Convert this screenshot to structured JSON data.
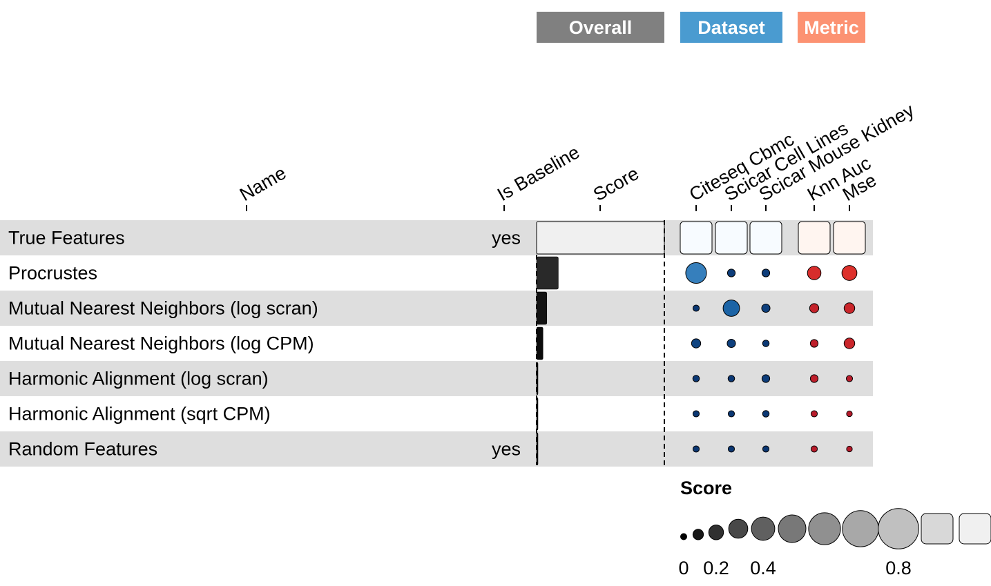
{
  "chart_data": {
    "type": "table",
    "groups": [
      {
        "label": "Overall",
        "color": "#808080"
      },
      {
        "label": "Dataset",
        "color": "#4A9BD0"
      },
      {
        "label": "Metric",
        "color": "#FC9272"
      }
    ],
    "columns": {
      "name": "Name",
      "is_baseline": "Is Baseline",
      "score": "Score",
      "datasets": [
        "Citeseq Cbmc",
        "Scicar Cell Lines",
        "Scicar Mouse Kidney"
      ],
      "metrics": [
        "Knn Auc",
        "Mse"
      ]
    },
    "rows": [
      {
        "name": "True Features",
        "is_baseline": "yes",
        "score": 1.0,
        "datasets": [
          1.0,
          1.0,
          1.0
        ],
        "metrics": [
          1.0,
          1.0
        ]
      },
      {
        "name": "Procrustes",
        "is_baseline": "",
        "score": 0.17,
        "datasets": [
          0.55,
          0.1,
          0.1
        ],
        "metrics": [
          0.3,
          0.35
        ]
      },
      {
        "name": "Mutual Nearest Neighbors (log scran)",
        "is_baseline": "",
        "score": 0.08,
        "datasets": [
          0.05,
          0.4,
          0.12
        ],
        "metrics": [
          0.15,
          0.2
        ]
      },
      {
        "name": "Mutual Nearest Neighbors (log CPM)",
        "is_baseline": "",
        "score": 0.05,
        "datasets": [
          0.15,
          0.12,
          0.06
        ],
        "metrics": [
          0.1,
          0.2
        ]
      },
      {
        "name": "Harmonic Alignment (log scran)",
        "is_baseline": "",
        "score": 0.01,
        "datasets": [
          0.06,
          0.06,
          0.1
        ],
        "metrics": [
          0.1,
          0.05
        ]
      },
      {
        "name": "Harmonic Alignment (sqrt CPM)",
        "is_baseline": "",
        "score": 0.0,
        "datasets": [
          0.05,
          0.05,
          0.06
        ],
        "metrics": [
          0.05,
          0.03
        ]
      },
      {
        "name": "Random Features",
        "is_baseline": "yes",
        "score": 0.0,
        "datasets": [
          0.05,
          0.05,
          0.05
        ],
        "metrics": [
          0.05,
          0.03
        ]
      }
    ],
    "legend": {
      "title": "Score",
      "steps": [
        0,
        0.1,
        0.2,
        0.3,
        0.4,
        0.5,
        0.6,
        0.7,
        0.8,
        0.9,
        1.0
      ],
      "tick_labels": [
        {
          "label": "0",
          "value": 0
        },
        {
          "label": "0.2",
          "value": 0.2
        },
        {
          "label": "0.4",
          "value": 0.4
        },
        {
          "label": "0.8",
          "value": 0.8
        }
      ]
    }
  }
}
